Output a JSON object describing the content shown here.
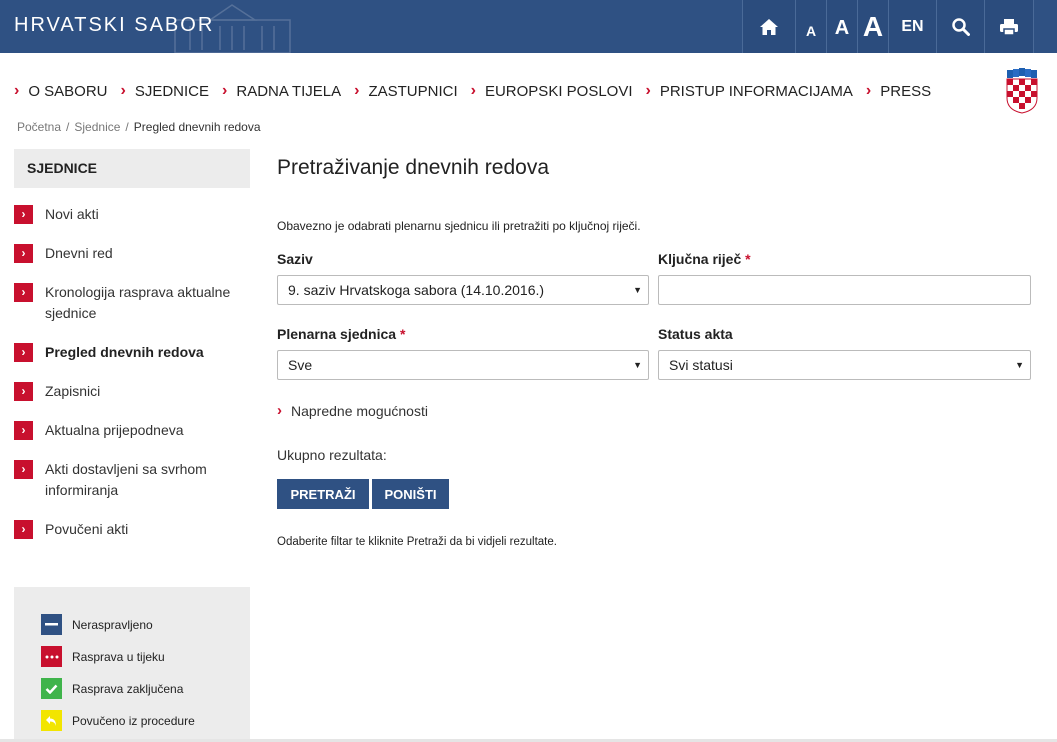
{
  "header": {
    "logo": "HRVATSKI SABOR",
    "font_small": "A",
    "font_medium": "A",
    "font_large": "A",
    "lang": "EN",
    "home_icon": "home-icon",
    "search_icon": "search-icon",
    "print_icon": "print-icon"
  },
  "nav": {
    "items": [
      "O SABORU",
      "SJEDNICE",
      "RADNA TIJELA",
      "ZASTUPNICI",
      "EUROPSKI POSLOVI",
      "PRISTUP INFORMACIJAMA",
      "PRESS"
    ]
  },
  "breadcrumb": {
    "home": "Početna",
    "sep": "/",
    "section": "Sjednice",
    "current": "Pregled dnevnih redova"
  },
  "sidebar": {
    "title": "SJEDNICE",
    "items": [
      "Novi akti",
      "Dnevni red",
      "Kronologija rasprava aktualne sjednice",
      "Pregled dnevnih redova",
      "Zapisnici",
      "Aktualna prijepodneva",
      "Akti dostavljeni sa svrhom informiranja",
      "Povučeni akti"
    ],
    "active_index": 3
  },
  "legend": {
    "items": [
      {
        "label": "Neraspravljeno",
        "color": "#2f5183",
        "icon": "minus-icon"
      },
      {
        "label": "Rasprava u tijeku",
        "color": "#c8102e",
        "icon": "dots-icon"
      },
      {
        "label": "Rasprava zaključena",
        "color": "#3fb44b",
        "icon": "check-icon"
      },
      {
        "label": "Povučeno iz procedure",
        "color": "#f2e500",
        "icon": "undo-arrow-icon"
      }
    ]
  },
  "main": {
    "title": "Pretraživanje dnevnih redova",
    "note": "Obavezno je odabrati plenarnu sjednicu ili pretražiti po ključnoj riječi.",
    "saziv_label": "Saziv",
    "saziv_value": "9. saziv Hrvatskoga sabora (14.10.2016.)",
    "keyword_label": "Ključna riječ",
    "keyword_value": "",
    "required_mark": "*",
    "plenarna_label": "Plenarna sjednica",
    "plenarna_value": "Sve",
    "status_label": "Status akta",
    "status_value": "Svi statusi",
    "advanced": "Napredne mogućnosti",
    "total": "Ukupno rezultata:",
    "search_button": "PRETRAŽI",
    "reset_button": "PONIŠTI",
    "hint": "Odaberite filtar te kliknite Pretraži da bi vidjeli rezultate."
  },
  "colors": {
    "brand_blue": "#2f5183",
    "accent_red": "#c8102e"
  }
}
